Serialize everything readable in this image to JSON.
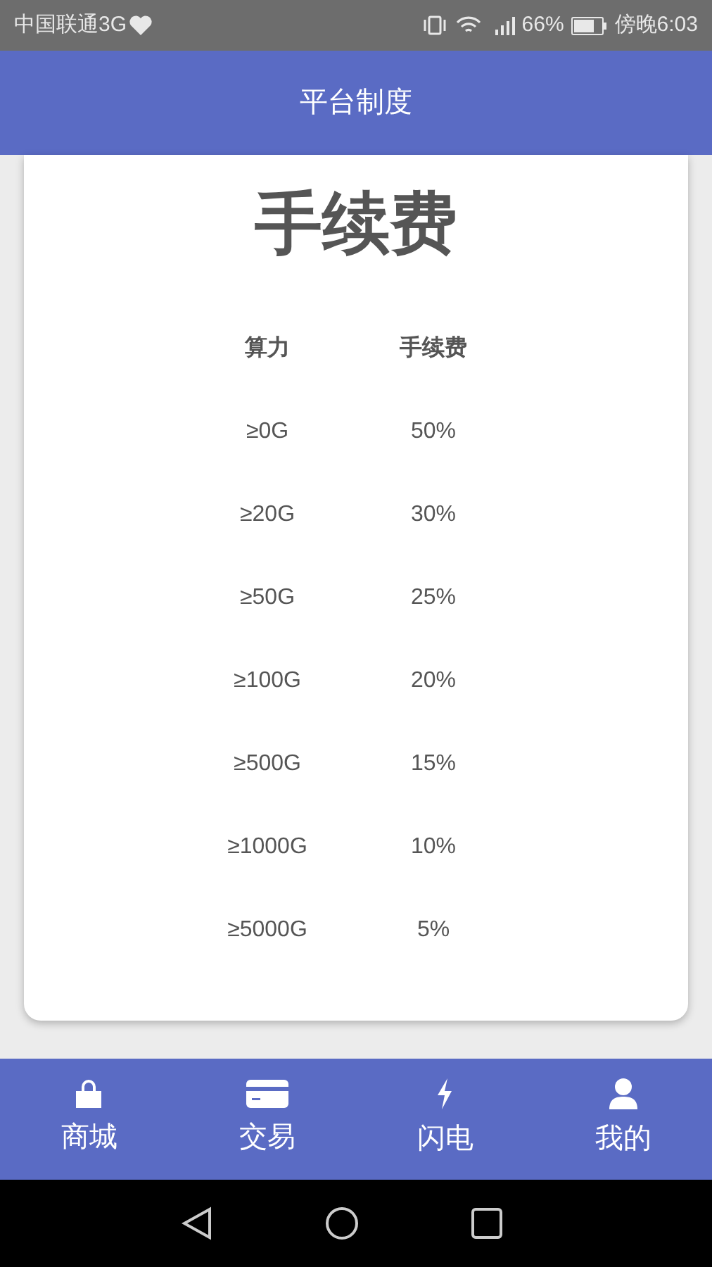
{
  "status_bar": {
    "carrier": "中国联通3G",
    "battery": "66%",
    "time": "傍晚6:03"
  },
  "header": {
    "title": "平台制度"
  },
  "card": {
    "title": "手续费",
    "columns": [
      "算力",
      "手续费"
    ],
    "rows": [
      [
        "≥0G",
        "50%"
      ],
      [
        "≥20G",
        "30%"
      ],
      [
        "≥50G",
        "25%"
      ],
      [
        "≥100G",
        "20%"
      ],
      [
        "≥500G",
        "15%"
      ],
      [
        "≥1000G",
        "10%"
      ],
      [
        "≥5000G",
        "5%"
      ]
    ]
  },
  "bottom_nav": [
    {
      "label": "商城",
      "kind": "shop",
      "selected": false
    },
    {
      "label": "交易",
      "kind": "card",
      "selected": false
    },
    {
      "label": "闪电",
      "kind": "bolt",
      "selected": false
    },
    {
      "label": "我的",
      "kind": "user",
      "selected": false
    }
  ]
}
